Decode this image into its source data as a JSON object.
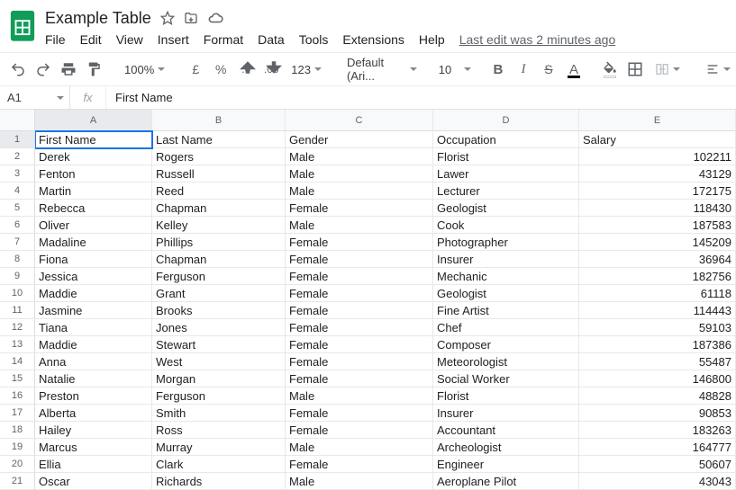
{
  "document": {
    "title": "Example Table"
  },
  "menu": {
    "items": [
      "File",
      "Edit",
      "View",
      "Insert",
      "Format",
      "Data",
      "Tools",
      "Extensions",
      "Help"
    ],
    "last_edit": "Last edit was 2 minutes ago"
  },
  "toolbar": {
    "zoom": "100%",
    "currency_symbol": "£",
    "percent_symbol": "%",
    "dec_less": ".0",
    "dec_more": ".00",
    "format_menu": "123",
    "font": "Default (Ari...",
    "font_size": "10"
  },
  "formula_bar": {
    "cell_ref": "A1",
    "fx_label": "fx",
    "value": "First Name"
  },
  "grid": {
    "columns": [
      "A",
      "B",
      "C",
      "D",
      "E"
    ],
    "active_cell": {
      "row": 0,
      "col": 0
    },
    "headers": [
      "First Name",
      "Last Name",
      "Gender",
      "Occupation",
      "Salary"
    ],
    "rows": [
      [
        "Derek",
        "Rogers",
        "Male",
        "Florist",
        "102211"
      ],
      [
        "Fenton",
        "Russell",
        "Male",
        "Lawer",
        "43129"
      ],
      [
        "Martin",
        "Reed",
        "Male",
        "Lecturer",
        "172175"
      ],
      [
        "Rebecca",
        "Chapman",
        "Female",
        "Geologist",
        "118430"
      ],
      [
        "Oliver",
        "Kelley",
        "Male",
        "Cook",
        "187583"
      ],
      [
        "Madaline",
        "Phillips",
        "Female",
        "Photographer",
        "145209"
      ],
      [
        "Fiona",
        "Chapman",
        "Female",
        "Insurer",
        "36964"
      ],
      [
        "Jessica",
        "Ferguson",
        "Female",
        "Mechanic",
        "182756"
      ],
      [
        "Maddie",
        "Grant",
        "Female",
        "Geologist",
        "61118"
      ],
      [
        "Jasmine",
        "Brooks",
        "Female",
        "Fine Artist",
        "114443"
      ],
      [
        "Tiana",
        "Jones",
        "Female",
        "Chef",
        "59103"
      ],
      [
        "Maddie",
        "Stewart",
        "Female",
        "Composer",
        "187386"
      ],
      [
        "Anna",
        "West",
        "Female",
        "Meteorologist",
        "55487"
      ],
      [
        "Natalie",
        "Morgan",
        "Female",
        "Social Worker",
        "146800"
      ],
      [
        "Preston",
        "Ferguson",
        "Male",
        "Florist",
        "48828"
      ],
      [
        "Alberta",
        "Smith",
        "Female",
        "Insurer",
        "90853"
      ],
      [
        "Hailey",
        "Ross",
        "Female",
        "Accountant",
        "183263"
      ],
      [
        "Marcus",
        "Murray",
        "Male",
        "Archeologist",
        "164777"
      ],
      [
        "Ellia",
        "Clark",
        "Female",
        "Engineer",
        "50607"
      ],
      [
        "Oscar",
        "Richards",
        "Male",
        "Aeroplane Pilot",
        "43043"
      ]
    ]
  }
}
